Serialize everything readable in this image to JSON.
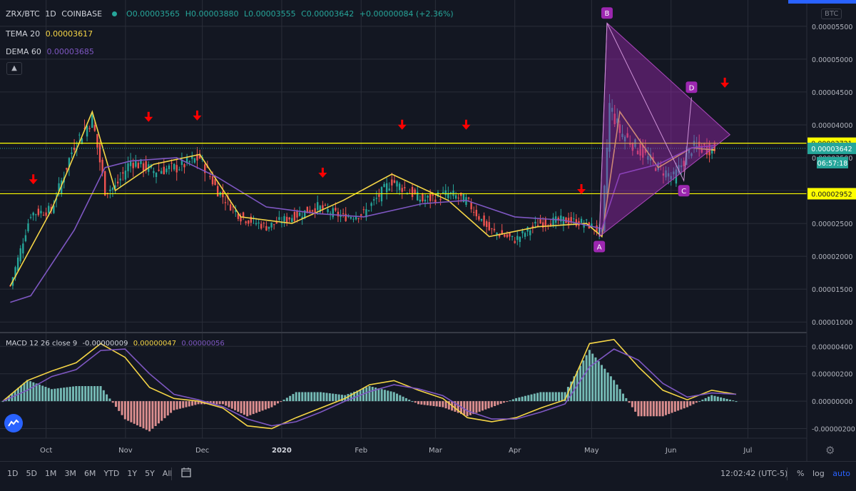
{
  "header": {
    "symbol": "ZRX/BTC",
    "interval": "1D",
    "exchange": "COINBASE",
    "open": "O0.00003565",
    "high": "H0.00003880",
    "low": "L0.00003555",
    "close": "C0.00003642",
    "change": "+0.00000084 (+2.36%)",
    "currency_badge": "BTC"
  },
  "indicators": {
    "tema_label": "TEMA 20",
    "tema_value": "0.00003617",
    "dema_label": "DEMA 60",
    "dema_value": "0.00003685",
    "macd_label": "MACD 12 26 close 9",
    "macd_hist": "-0.00000009",
    "macd_line": "0.00000047",
    "macd_signal": "0.00000056"
  },
  "price_labels": {
    "level_high": "0.00003721",
    "last_price": "0.00003642",
    "countdown": "06:57:18",
    "level_low": "0.00002952"
  },
  "pattern_points": [
    "A",
    "B",
    "C",
    "D"
  ],
  "bottombar": {
    "ranges": [
      "1D",
      "5D",
      "1M",
      "3M",
      "6M",
      "YTD",
      "1Y",
      "5Y",
      "All"
    ],
    "clock": "12:02:42 (UTC-5)",
    "percent": "%",
    "log": "log",
    "auto": "auto"
  },
  "colors": {
    "up": "#26a69a",
    "down": "#ef5350",
    "tema": "#f5d546",
    "dema": "#7e57c2",
    "level": "#ffff00",
    "pattern": "#9c27b0",
    "arrow": "#ff0000"
  },
  "chart_data": [
    {
      "type": "line",
      "title": "ZRX/BTC 1D COINBASE",
      "x_ticks": [
        "Oct",
        "Nov",
        "Dec",
        "2020",
        "Feb",
        "Mar",
        "Apr",
        "May",
        "Jun",
        "Jul"
      ],
      "y_ticks": [
        "0.00005500",
        "0.00005000",
        "0.00004500",
        "0.00004000",
        "0.00003500",
        "0.00003000",
        "0.00002500",
        "0.00002000",
        "0.00001500",
        "0.00001000"
      ],
      "ylim": [
        8.5e-06,
        5.9e-05
      ],
      "horizontal_levels": [
        3.721e-05,
        2.952e-05
      ],
      "series": [
        {
          "name": "Close",
          "x": [
            "2019-09-17",
            "2019-09-25",
            "2019-10-03",
            "2019-10-12",
            "2019-10-19",
            "2019-10-24",
            "2019-10-28",
            "2019-11-03",
            "2019-11-12",
            "2019-11-21",
            "2019-11-30",
            "2019-12-07",
            "2019-12-16",
            "2019-12-26",
            "2020-01-05",
            "2020-01-15",
            "2020-01-25",
            "2020-02-02",
            "2020-02-13",
            "2020-02-25",
            "2020-03-06",
            "2020-03-13",
            "2020-03-22",
            "2020-04-01",
            "2020-04-10",
            "2020-04-20",
            "2020-04-29",
            "2020-05-05",
            "2020-05-08",
            "2020-05-12",
            "2020-05-20",
            "2020-05-27",
            "2020-06-02",
            "2020-06-09",
            "2020-06-18"
          ],
          "values": [
            1.55e-05,
            2.65e-05,
            2.7e-05,
            3.7e-05,
            4.1e-05,
            3e-05,
            3.05e-05,
            3.45e-05,
            3.3e-05,
            3.35e-05,
            3.5e-05,
            3e-05,
            2.6e-05,
            2.45e-05,
            2.6e-05,
            2.75e-05,
            2.6e-05,
            2.65e-05,
            3.15e-05,
            2.85e-05,
            2.95e-05,
            2.85e-05,
            2.4e-05,
            2.25e-05,
            2.5e-05,
            2.55e-05,
            2.5e-05,
            2.35e-05,
            4.3e-05,
            3.9e-05,
            3.6e-05,
            3.35e-05,
            3.2e-05,
            3.65e-05,
            3.64e-05
          ]
        },
        {
          "name": "TEMA 20",
          "x": [
            "2019-09-17",
            "2019-10-03",
            "2019-10-19",
            "2019-10-28",
            "2019-11-12",
            "2019-11-30",
            "2019-12-16",
            "2020-01-05",
            "2020-01-25",
            "2020-02-13",
            "2020-03-06",
            "2020-03-22",
            "2020-04-10",
            "2020-04-29",
            "2020-05-05",
            "2020-05-12",
            "2020-05-27",
            "2020-06-09",
            "2020-06-18"
          ],
          "values": [
            1.55e-05,
            2.7e-05,
            4.2e-05,
            3e-05,
            3.4e-05,
            3.55e-05,
            2.6e-05,
            2.5e-05,
            2.85e-05,
            3.25e-05,
            2.85e-05,
            2.3e-05,
            2.45e-05,
            2.5e-05,
            2.3e-05,
            4.2e-05,
            3.35e-05,
            3.65e-05,
            3.617e-05
          ]
        },
        {
          "name": "DEMA 60",
          "x": [
            "2019-09-17",
            "2019-09-25",
            "2019-10-12",
            "2019-10-24",
            "2019-11-03",
            "2019-11-21",
            "2019-12-07",
            "2019-12-26",
            "2020-01-15",
            "2020-02-02",
            "2020-02-25",
            "2020-03-13",
            "2020-04-01",
            "2020-04-20",
            "2020-05-05",
            "2020-05-12",
            "2020-05-27",
            "2020-06-09",
            "2020-06-18"
          ],
          "values": [
            1.3e-05,
            1.4e-05,
            2.4e-05,
            3.35e-05,
            3.45e-05,
            3.5e-05,
            3.2e-05,
            2.75e-05,
            2.65e-05,
            2.6e-05,
            2.8e-05,
            2.85e-05,
            2.6e-05,
            2.55e-05,
            2.42e-05,
            3.25e-05,
            3.4e-05,
            3.65e-05,
            3.685e-05
          ]
        }
      ]
    },
    {
      "type": "line",
      "title": "MACD 12 26 close 9",
      "y_ticks": [
        "0.00000400",
        "0.00000200",
        "0.00000000",
        "-0.00000200"
      ],
      "ylim": [
        -2.7e-06,
        4.9e-06
      ],
      "series": [
        {
          "name": "MACD",
          "values": [
            0,
            1.5e-06,
            2.2e-06,
            2.8e-06,
            4.2e-06,
            3.2e-06,
            1e-06,
            2e-07,
            0,
            -5e-07,
            -1.8e-06,
            -2e-06,
            -1.2e-06,
            -5e-07,
            2e-07,
            1.2e-06,
            1.5e-06,
            8e-07,
            2e-07,
            -1.2e-06,
            -1.5e-06,
            -1.2e-06,
            -5e-07,
            1e-07,
            4.2e-06,
            4.5e-06,
            2.5e-06,
            8e-07,
            1e-07,
            8e-07,
            5e-07
          ]
        },
        {
          "name": "Signal",
          "values": [
            0,
            8e-07,
            1.8e-06,
            2.3e-06,
            3.7e-06,
            3.8e-06,
            2e-06,
            5e-07,
            1e-07,
            -4e-07,
            -1.3e-06,
            -1.8e-06,
            -1.5e-06,
            -8e-07,
            0,
            7e-07,
            1.2e-06,
            9e-07,
            4e-07,
            -7e-07,
            -1.3e-06,
            -1.3e-06,
            -8e-07,
            -2e-07,
            2.5e-06,
            3.8e-06,
            3e-06,
            1.3e-06,
            3e-07,
            6e-07,
            5e-07
          ]
        }
      ]
    }
  ]
}
